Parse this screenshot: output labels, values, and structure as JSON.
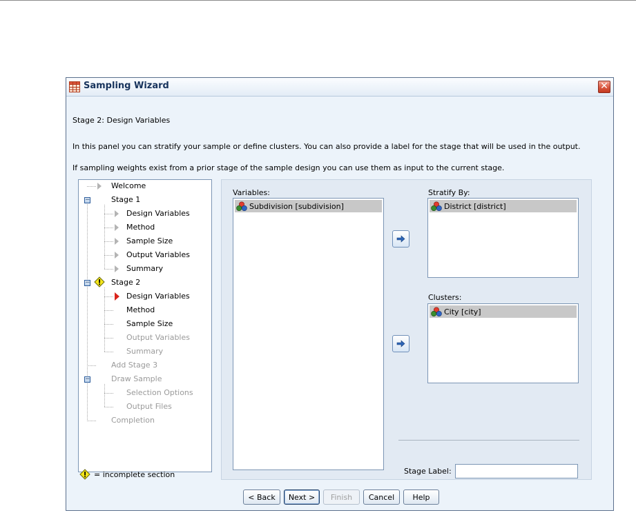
{
  "window": {
    "title": "Sampling Wizard",
    "close_glyph": "✕"
  },
  "heading": "Stage 2: Design Variables",
  "description_1": "In this panel you can stratify your sample or define clusters. You can also provide a label for the stage that will be used in the output.",
  "description_2": "If sampling weights exist from a prior stage of the sample design you can use them as input to the current stage.",
  "tree": {
    "items": [
      {
        "label": "Welcome",
        "enabled": true
      },
      {
        "label": "Stage 1",
        "enabled": true
      },
      {
        "label": "Design Variables",
        "enabled": true
      },
      {
        "label": "Method",
        "enabled": true
      },
      {
        "label": "Sample Size",
        "enabled": true
      },
      {
        "label": "Output Variables",
        "enabled": true
      },
      {
        "label": "Summary",
        "enabled": true
      },
      {
        "label": "Stage 2",
        "enabled": true
      },
      {
        "label": "Design Variables",
        "enabled": true,
        "current": true
      },
      {
        "label": "Method",
        "enabled": true
      },
      {
        "label": "Sample Size",
        "enabled": true
      },
      {
        "label": "Output Variables",
        "enabled": false
      },
      {
        "label": "Summary",
        "enabled": false
      },
      {
        "label": "Add Stage 3",
        "enabled": false
      },
      {
        "label": "Draw Sample",
        "enabled": false
      },
      {
        "label": "Selection Options",
        "enabled": false
      },
      {
        "label": "Output Files",
        "enabled": false
      },
      {
        "label": "Completion",
        "enabled": false
      }
    ],
    "expander_glyph": "−"
  },
  "legend": {
    "text": "= incomplete section"
  },
  "variables": {
    "label": "Variables:",
    "items": [
      "Subdivision [subdivision]"
    ]
  },
  "stratify": {
    "label": "Stratify By:",
    "items": [
      "District [district]"
    ]
  },
  "clusters": {
    "label": "Clusters:",
    "items": [
      "City [city]"
    ]
  },
  "stage_label": {
    "label": "Stage Label:",
    "value": ""
  },
  "buttons": {
    "back": "< Back",
    "next": "Next >",
    "finish": "Finish",
    "cancel": "Cancel",
    "help": "Help"
  },
  "colors": {
    "window_bg": "#ECF3FA",
    "panel_bg": "#E2EAF3",
    "selected_item": "#C8C8C8",
    "title_text": "#17335C",
    "incomplete_icon": "#F5E61A",
    "current_marker": "#D9241C"
  },
  "icons": {
    "app": "table-grid-icon",
    "variable": "nominal-variable-icon",
    "move": "right-arrow-icon",
    "warning": "incomplete-warning-icon",
    "expander": "tree-collapse-icon",
    "close": "close-icon"
  }
}
